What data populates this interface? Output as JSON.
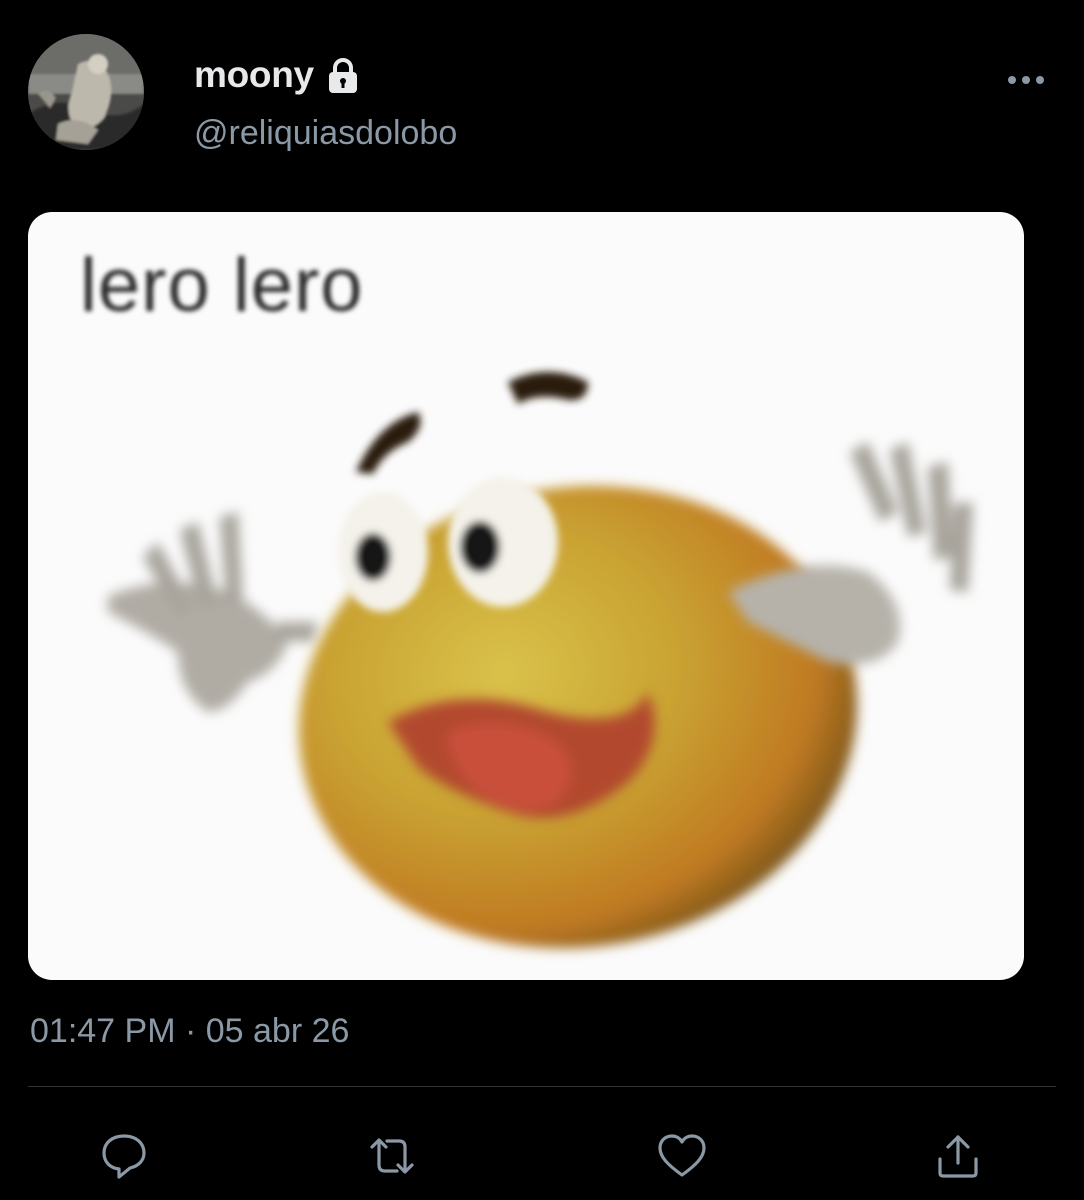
{
  "tweet": {
    "display_name": "moony",
    "handle": "@reliquiasdolobo",
    "protected_icon": "lock-icon",
    "media": {
      "caption_text": "lero lero"
    },
    "timestamp": "01:47 PM · 05 abr 26"
  },
  "actions": [
    {
      "name": "reply",
      "icon": "reply-icon"
    },
    {
      "name": "retweet",
      "icon": "retweet-icon"
    },
    {
      "name": "like",
      "icon": "heart-icon"
    },
    {
      "name": "share",
      "icon": "share-icon"
    }
  ],
  "colors": {
    "background": "#000000",
    "primary_text": "#e7e9ea",
    "secondary_text": "#8b98a5",
    "divider": "#2f3336"
  }
}
